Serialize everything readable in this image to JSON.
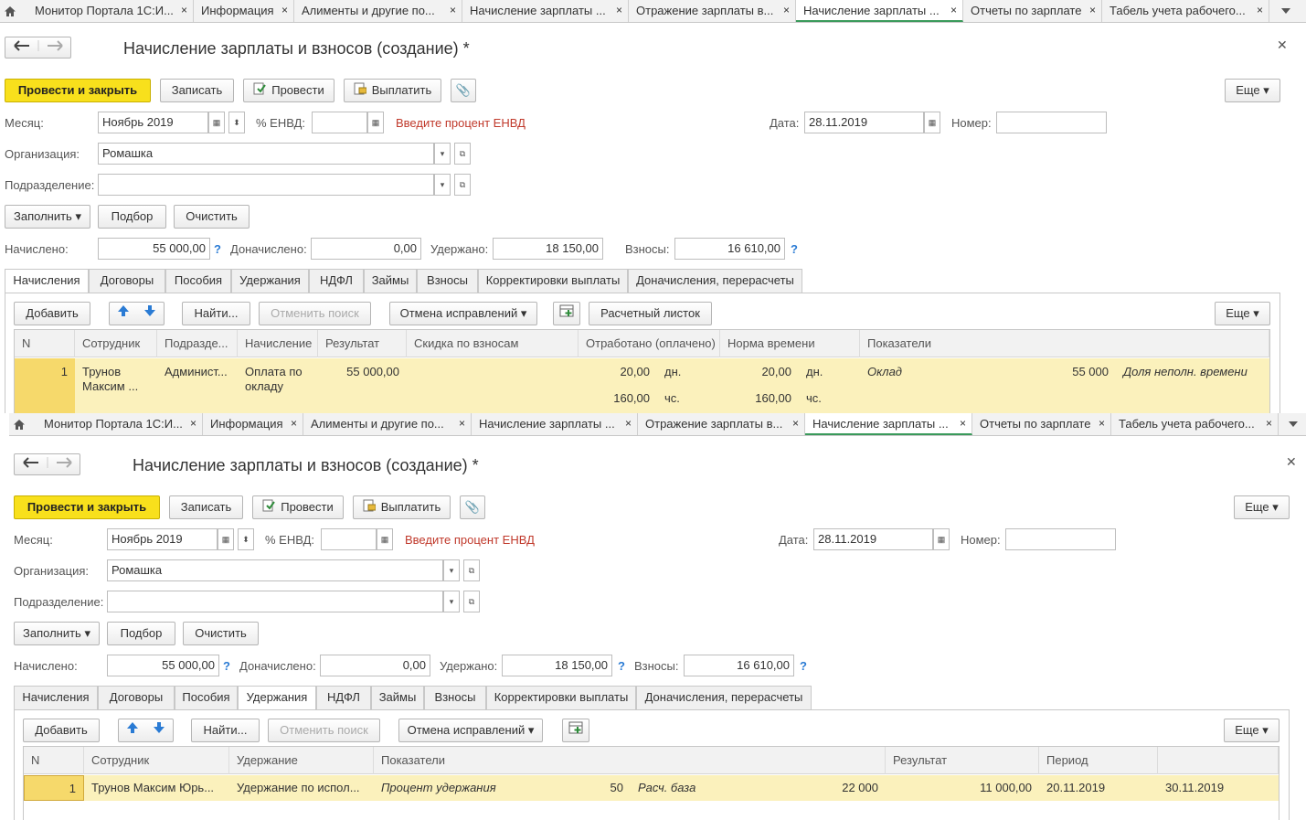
{
  "tabs": [
    "Монитор Портала 1С:И...",
    "Информация",
    "Алименты и другие по...",
    "Начисление зарплаты ...",
    "Отражение зарплаты в...",
    "Начисление зарплаты ...",
    "Отчеты по зарплате",
    "Табель учета рабочего..."
  ],
  "tab_close": "×",
  "form": {
    "title": "Начисление зарплаты и взносов (создание) *",
    "post_close": "Провести и закрыть",
    "save": "Записать",
    "post": "Провести",
    "pay": "Выплатить",
    "more": "Еще",
    "month_label": "Месяц:",
    "month_value": "Ноябрь 2019",
    "envd_label": "% ЕНВД:",
    "envd_value": "",
    "envd_warning": "Введите процент ЕНВД",
    "date_label": "Дата:",
    "date_value": "28.11.2019",
    "number_label": "Номер:",
    "number_value": "",
    "org_label": "Организация:",
    "org_value": "Ромашка",
    "dept_label": "Подразделение:",
    "dept_value": "",
    "fill": "Заполнить",
    "pick": "Подбор",
    "clear": "Очистить",
    "accrued_label": "Начислено:",
    "accrued_value": "55 000,00",
    "extra_label": "Доначислено:",
    "extra_value": "0,00",
    "withheld_label": "Удержано:",
    "withheld_value": "18 150,00",
    "contrib_label": "Взносы:",
    "contrib_value": "16 610,00",
    "help": "?"
  },
  "form_tabs": [
    "Начисления",
    "Договоры",
    "Пособия",
    "Удержания",
    "НДФЛ",
    "Займы",
    "Взносы",
    "Корректировки выплаты",
    "Доначисления, перерасчеты"
  ],
  "table_toolbar": {
    "add": "Добавить",
    "find": "Найти...",
    "cancel_search": "Отменить поиск",
    "cancel_fixes": "Отмена исправлений",
    "payslip": "Расчетный листок",
    "more": "Еще"
  },
  "panel1": {
    "active_tab": "Начисления",
    "columns": [
      "N",
      "Сотрудник",
      "Подразде...",
      "Начисление",
      "Результат",
      "Скидка по взносам",
      "Отработано (оплачено)",
      "Норма времени",
      "Показатели"
    ],
    "row": {
      "n": "1",
      "employee": "Трунов Максим ...",
      "dept": "Админист...",
      "accrual": "Оплата по окладу",
      "result": "55 000,00",
      "discount": "",
      "worked_days": "20,00",
      "worked_days_unit": "дн.",
      "worked_hours": "160,00",
      "worked_hours_unit": "чс.",
      "norm_days": "20,00",
      "norm_days_unit": "дн.",
      "norm_hours": "160,00",
      "norm_hours_unit": "чс.",
      "ind1_name": "Оклад",
      "ind1_value": "55 000",
      "ind2_name": "Доля неполн. времени"
    }
  },
  "panel2": {
    "active_tab": "Удержания",
    "columns": [
      "N",
      "Сотрудник",
      "Удержание",
      "Показатели",
      "Результат",
      "Период",
      ""
    ],
    "row": {
      "n": "1",
      "employee": "Трунов Максим Юрь...",
      "deduction": "Удержание по испол...",
      "ind1_name": "Процент удержания",
      "ind1_value": "50",
      "ind2_name": "Расч. база",
      "ind2_value": "22 000",
      "result": "11 000,00",
      "period_from": "20.11.2019",
      "period_to": "30.11.2019"
    }
  },
  "colors": {
    "accent_yellow": "#f8e01c",
    "row_highlight": "#fbf1bc",
    "active_tab_underline": "#3a9a5b",
    "warning_red": "#c0392b",
    "help_blue": "#2a7bd4"
  }
}
